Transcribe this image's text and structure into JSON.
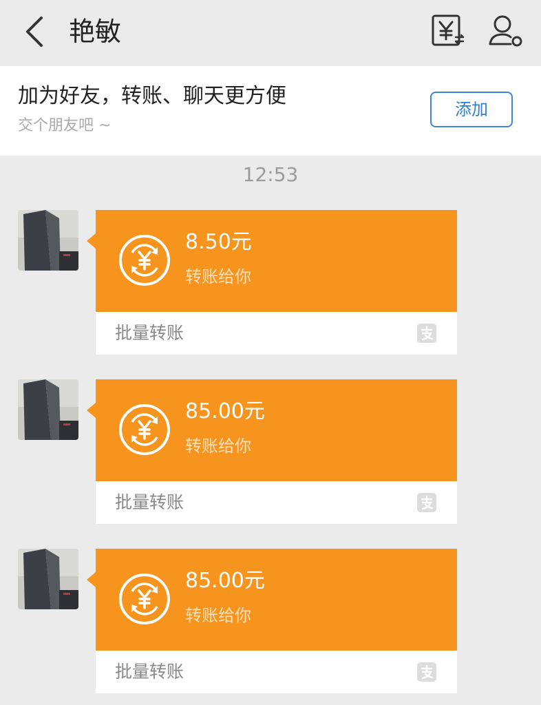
{
  "header": {
    "title": "艳敏",
    "icons": [
      "back-icon",
      "transfer-icon",
      "profile-icon"
    ]
  },
  "add_friend_bar": {
    "title": "加为好友，转账、聊天更方便",
    "subtitle": "交个朋友吧 ~",
    "button_label": "添加"
  },
  "chat": {
    "timestamp": "12:53",
    "messages": [
      {
        "amount": "8.50元",
        "subtitle": "转账给你",
        "footer": "批量转账"
      },
      {
        "amount": "85.00元",
        "subtitle": "转账给你",
        "footer": "批量转账"
      },
      {
        "amount": "85.00元",
        "subtitle": "转账给你",
        "footer": "批量转账"
      }
    ]
  },
  "colors": {
    "card_orange": "#f7941d",
    "link_blue": "#2f7fd1",
    "background": "#ebebeb"
  }
}
